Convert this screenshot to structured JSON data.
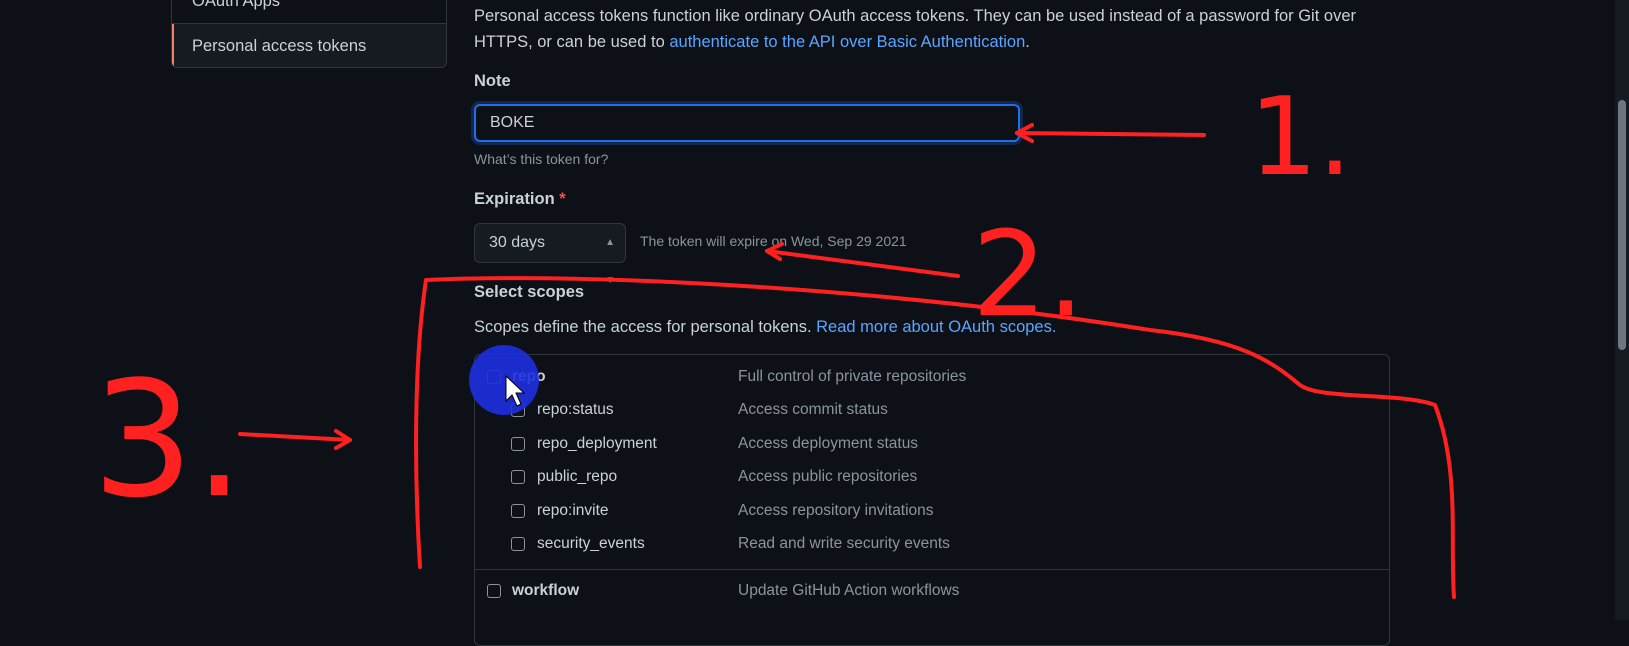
{
  "sidebar": {
    "items": [
      {
        "label": "OAuth Apps"
      },
      {
        "label": "Personal access tokens"
      }
    ]
  },
  "intro": {
    "text": "Personal access tokens function like ordinary OAuth access tokens. They can be used instead of a password for Git over HTTPS, or can be used to ",
    "link": "authenticate to the API over Basic Authentication",
    "suffix": "."
  },
  "note": {
    "label": "Note",
    "value": "BOKE",
    "hint": "What’s this token for?"
  },
  "expiration": {
    "label": "Expiration",
    "required_mark": "*",
    "selected": "30 days",
    "hint": "The token will expire on Wed, Sep 29 2021"
  },
  "scopes": {
    "label": "Select scopes",
    "desc": "Scopes define the access for personal tokens. ",
    "link": "Read more about OAuth scopes.",
    "items": [
      {
        "name": "repo",
        "desc": "Full control of private repositories"
      },
      {
        "name": "repo:status",
        "desc": "Access commit status"
      },
      {
        "name": "repo_deployment",
        "desc": "Access deployment status"
      },
      {
        "name": "public_repo",
        "desc": "Access public repositories"
      },
      {
        "name": "repo:invite",
        "desc": "Access repository invitations"
      },
      {
        "name": "security_events",
        "desc": "Read and write security events"
      },
      {
        "name": "workflow",
        "desc": "Update GitHub Action workflows"
      }
    ]
  },
  "annotations": {
    "step1": "1.",
    "step2": "2.",
    "step3": "3."
  },
  "colors": {
    "background": "#0d1117",
    "link": "#58a6ff",
    "focus": "#1f6feb",
    "annotation": "#ff2020",
    "cursor_highlight": "#1d2fe0"
  },
  "icons": [
    "select-arrows-icon",
    "mouse-cursor-icon"
  ]
}
